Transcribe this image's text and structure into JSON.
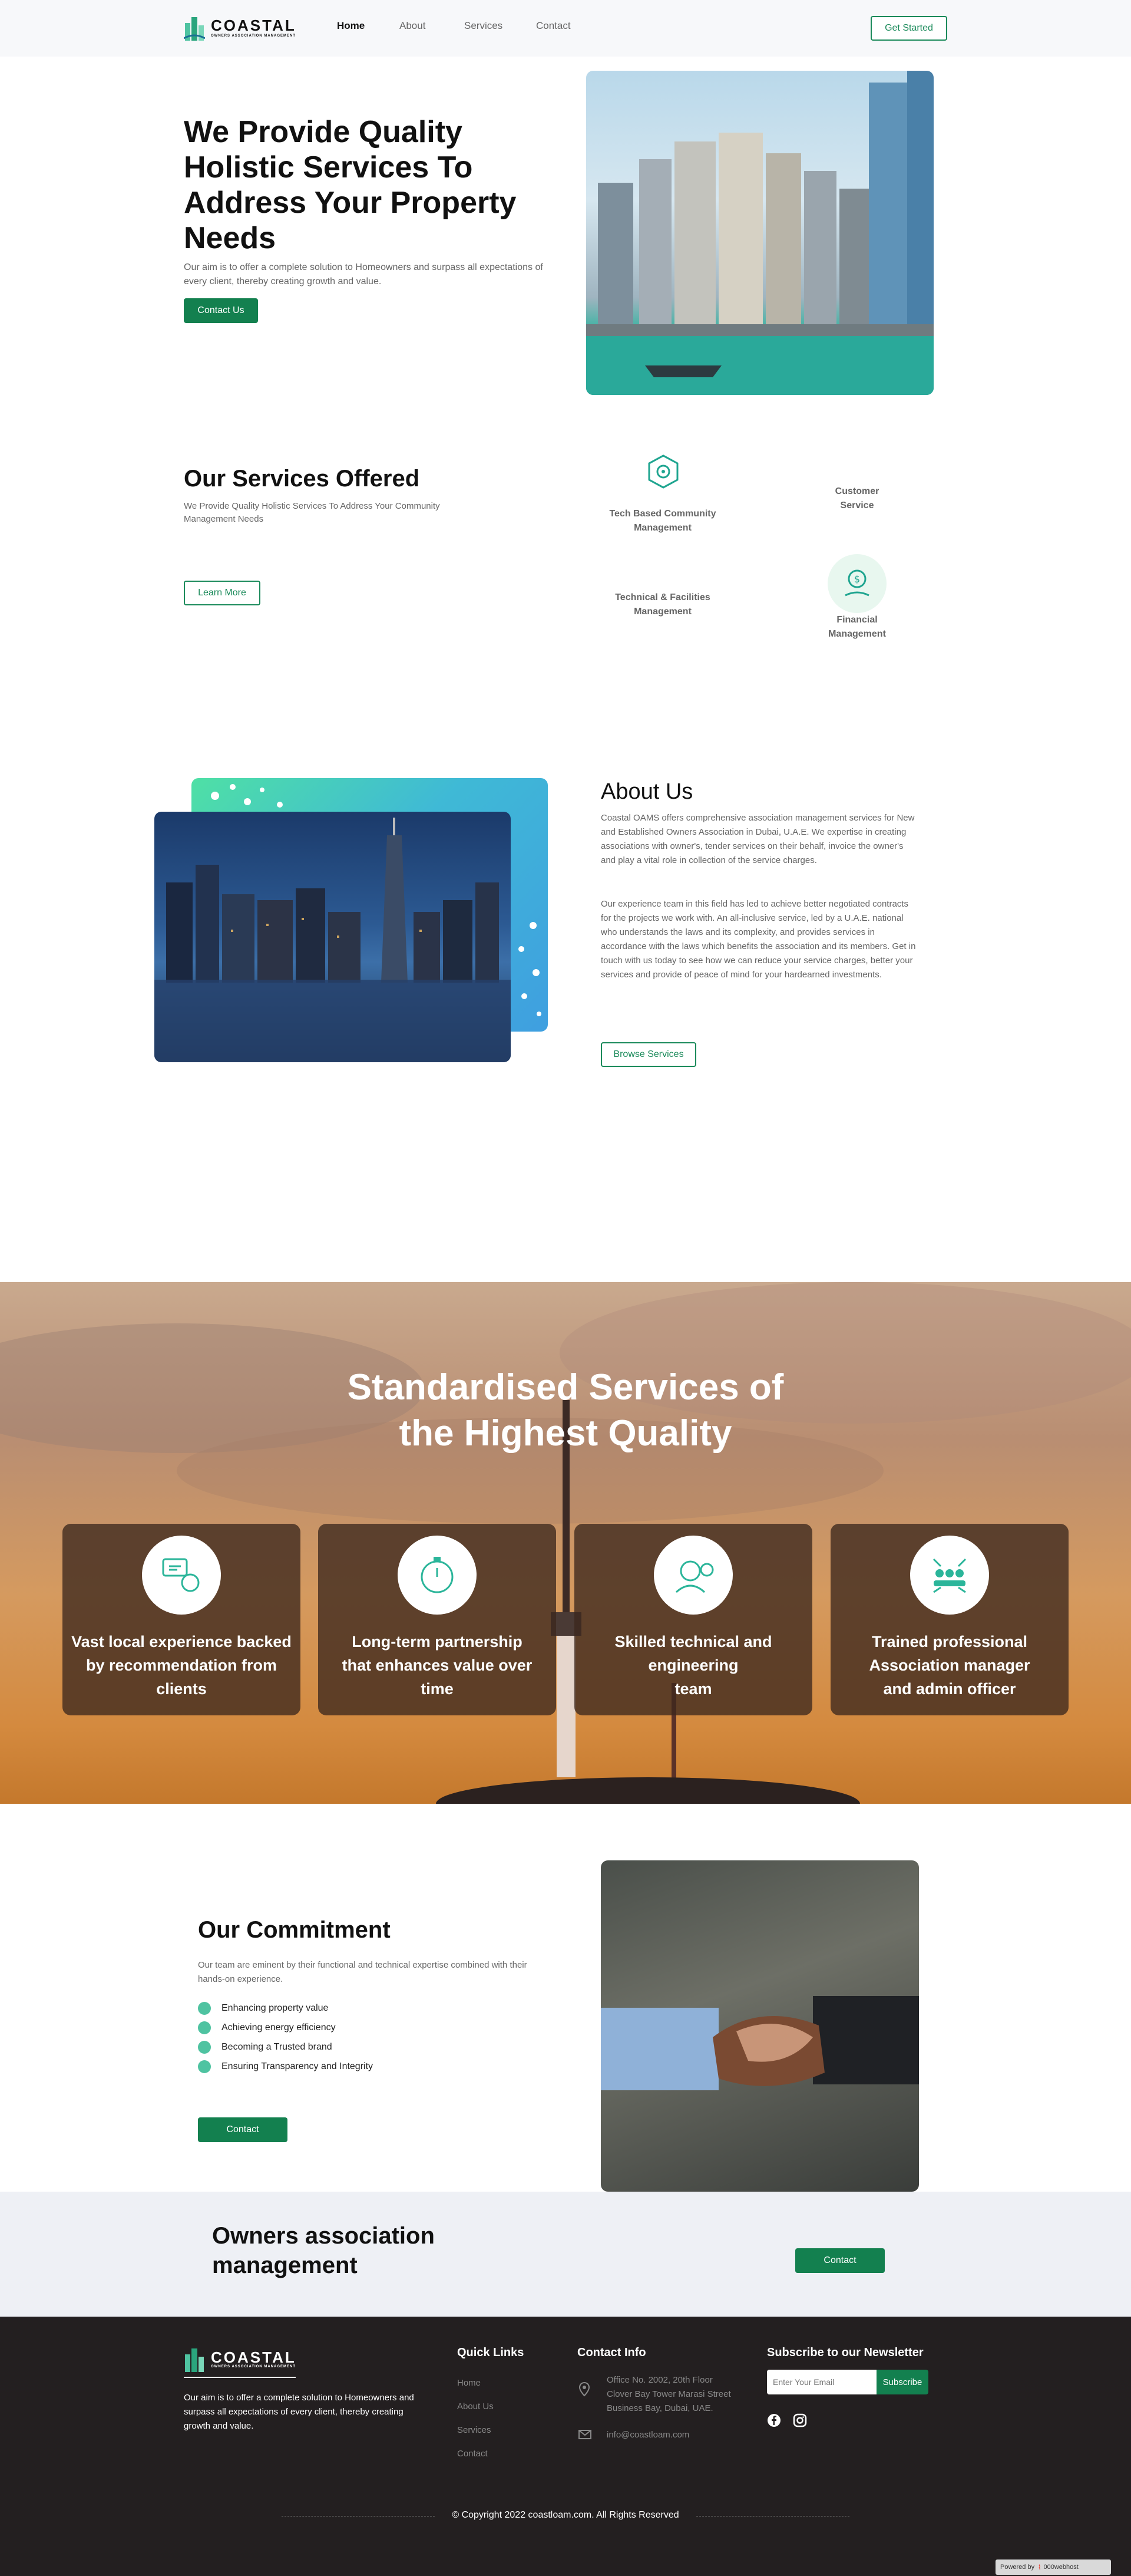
{
  "nav": {
    "brand": "COASTAL",
    "brand_sub": "OWNERS ASSOCIATION MANAGEMENT",
    "links": [
      "Home",
      "About",
      "Services",
      "Contact"
    ],
    "cta": "Get Started"
  },
  "hero": {
    "title": "We Provide Quality Holistic Services To Address Your Property Needs",
    "text": "Our aim is to offer a complete solution to Homeowners and surpass all expectations of every client, thereby creating growth and value.",
    "button": "Contact Us"
  },
  "services": {
    "title": "Our Services Offered",
    "text": "We Provide Quality Holistic Services To Address Your Community Management Needs",
    "button": "Learn More",
    "items": [
      "Tech Based Community Management",
      "Customer Service",
      "Technical & Facilities Management",
      "Financial Management"
    ]
  },
  "about": {
    "title": "About Us",
    "p1": "Coastal OAMS offers comprehensive association management services for New and Established Owners Association in Dubai, U.A.E. We expertise in creating associations with owner's, tender services on their behalf, invoice the owner's and play a vital role in collection of the service charges.",
    "p2": "Our experience team in this field has led to achieve better negotiated contracts for the projects we work with. An all-inclusive service, led by a U.A.E. national who understands the laws and its complexity, and provides services in accordance with the laws which benefits the association and its members. Get in touch with us today to see how we can reduce your service charges, better your services and provide of peace of mind for your hardearned investments.",
    "button": "Browse Services"
  },
  "features": {
    "title_line1": "Standardised Services of",
    "title_line2": "the Highest Quality",
    "cards": [
      {
        "line1": "Vast local experience backed",
        "line2": "by recommendation from",
        "line3": "clients"
      },
      {
        "line1": "Long-term partnership",
        "line2": "that enhances value over",
        "line3": "time"
      },
      {
        "line1": "Skilled technical and",
        "line2": "engineering",
        "line3": "team"
      },
      {
        "line1": "Trained professional",
        "line2": "Association manager",
        "line3": "and admin officer"
      }
    ]
  },
  "commitment": {
    "title": "Our Commitment",
    "text": "Our team are eminent by their functional and technical expertise combined with their hands-on experience.",
    "items": [
      "Enhancing property value",
      "Achieving energy efficiency",
      "Becoming a Trusted brand",
      "Ensuring Transparency and Integrity"
    ],
    "button": "Contact"
  },
  "cta_band": {
    "line1": "Owners association",
    "line2": "management",
    "button": "Contact"
  },
  "footer": {
    "about": "Our aim is to offer a complete solution to Homeowners and surpass all expectations of every client, thereby creating growth and value.",
    "quick_title": "Quick Links",
    "quick_links": [
      "Home",
      "About Us",
      "Services",
      "Contact"
    ],
    "contact_title": "Contact Info",
    "address_line1": "Office No. 2002, 20th Floor",
    "address_line2": "Clover Bay Tower Marasi Street",
    "address_line3": "Business Bay, Dubai, UAE.",
    "email": "info@coastloam.com",
    "newsletter_title": "Subscribe to our Newsletter",
    "email_placeholder": "Enter Your Email",
    "subscribe": "Subscribe",
    "copyright": "© Copyright 2022 coastloam.com. All Rights Reserved",
    "powered": "Powered by",
    "host": "000webhost"
  },
  "colors": {
    "accent": "#13804f",
    "teal": "#4fc3a1",
    "footer_bg": "#231f20"
  }
}
